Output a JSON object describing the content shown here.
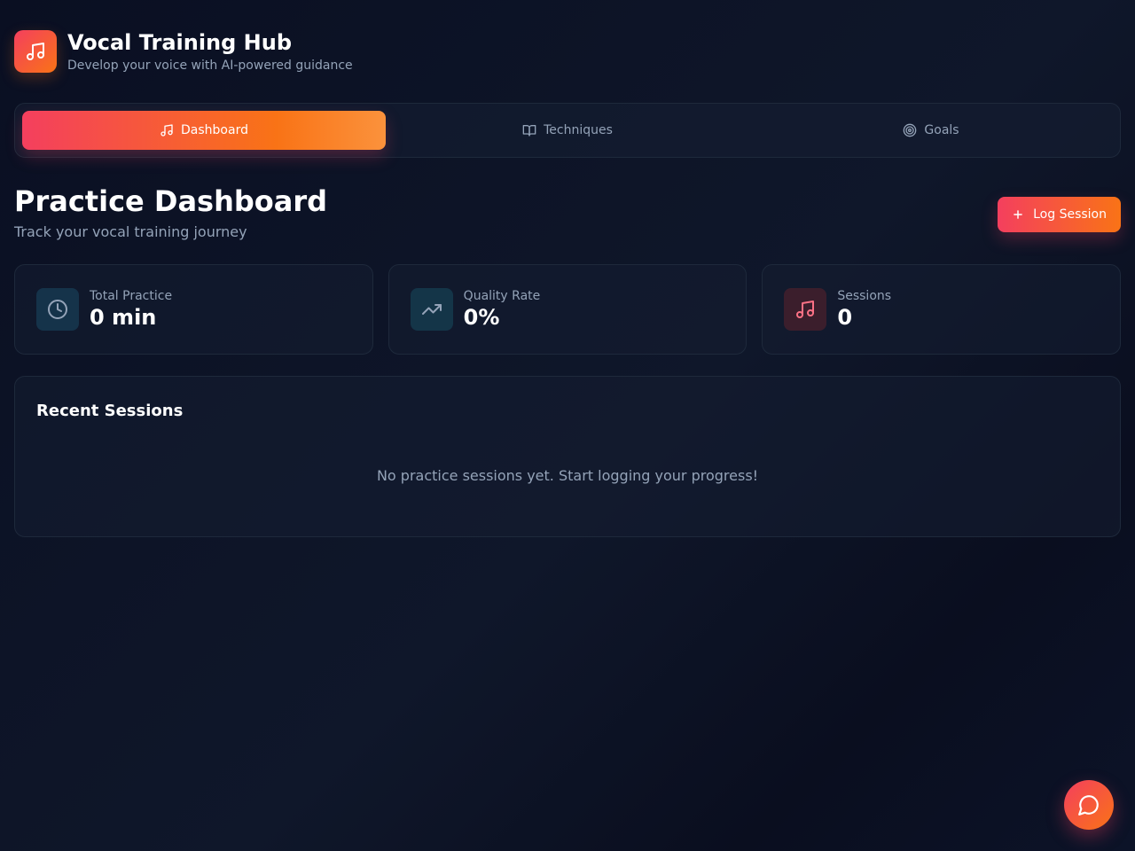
{
  "app": {
    "title": "Vocal Training Hub",
    "subtitle": "Develop your voice with AI-powered guidance",
    "logo_icon": "music-note-icon"
  },
  "tabs": [
    {
      "label": "Dashboard",
      "icon": "music-note-icon",
      "active": true
    },
    {
      "label": "Techniques",
      "icon": "book-open-icon",
      "active": false
    },
    {
      "label": "Goals",
      "icon": "target-icon",
      "active": false
    }
  ],
  "page": {
    "title": "Practice Dashboard",
    "subtitle": "Track your vocal training journey",
    "log_button_label": "Log Session",
    "log_button_icon": "plus-icon"
  },
  "stats": [
    {
      "label": "Total Practice",
      "value": "0 min",
      "icon": "clock-icon"
    },
    {
      "label": "Quality Rate",
      "value": "0%",
      "icon": "trending-up-icon"
    },
    {
      "label": "Sessions",
      "value": "0",
      "icon": "music-note-icon"
    }
  ],
  "recent_sessions": {
    "title": "Recent Sessions",
    "empty_message": "No practice sessions yet. Start logging your progress!"
  },
  "chat": {
    "icon": "chat-bubble-icon"
  },
  "colors": {
    "accent_start": "#f43f5e",
    "accent_end": "#f97316",
    "background": "#0f172a",
    "card_border": "#1e293b",
    "muted_text": "#94a3b8"
  }
}
